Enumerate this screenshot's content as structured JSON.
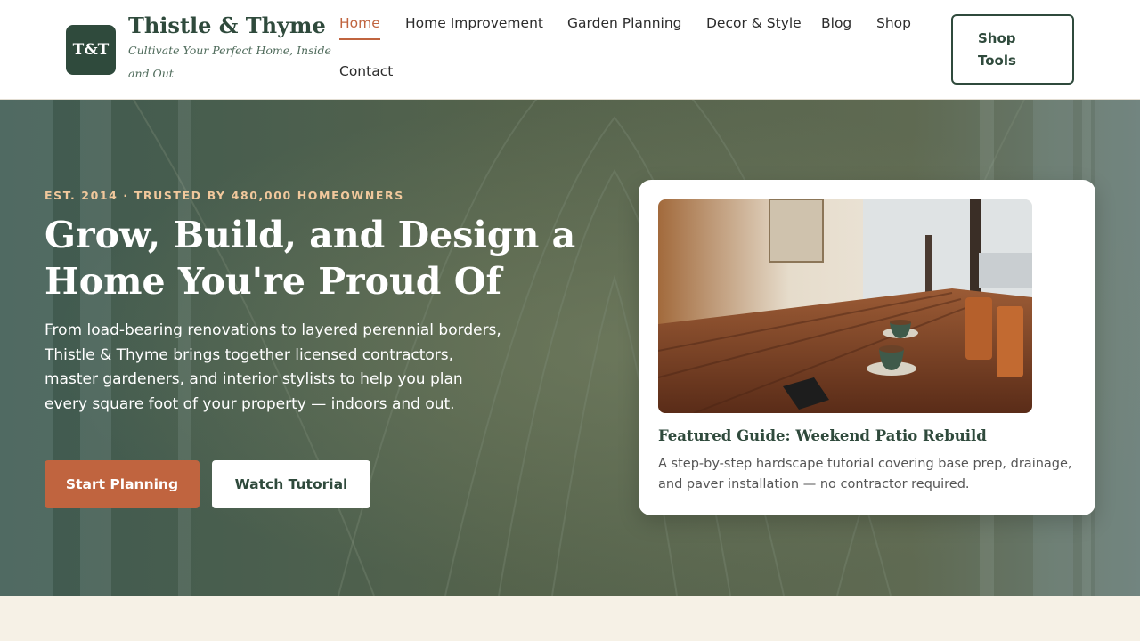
{
  "brand": {
    "logo_text": "T&T",
    "name": "Thistle & Thyme",
    "tagline": "Cultivate Your Perfect Home, Inside and Out"
  },
  "nav": {
    "items": [
      {
        "label": "Home",
        "active": true
      },
      {
        "label": "Home Improvement"
      },
      {
        "label": "Garden Planning"
      },
      {
        "label": "Decor & Style"
      },
      {
        "label": "Blog"
      },
      {
        "label": "Shop"
      },
      {
        "label": "Contact"
      }
    ],
    "shop_tools": "Shop Tools"
  },
  "hero": {
    "eyebrow": "EST. 2014 · TRUSTED BY 480,000 HOMEOWNERS",
    "title": "Grow, Build, and Design a Home You're Proud Of",
    "description": "From load-bearing renovations to layered perennial borders, Thistle & Thyme brings together licensed contractors, master gardeners, and interior stylists to help you plan every square foot of your property — indoors and out.",
    "primary_cta": "Start Planning",
    "secondary_cta": "Watch Tutorial"
  },
  "featured": {
    "title": "Featured Guide: Weekend Patio Rebuild",
    "description": "A step-by-step hardscape tutorial covering base prep, drainage, and paver installation — no contractor required."
  },
  "colors": {
    "brand_green": "#2f4a3c",
    "accent_terracotta": "#c0643f",
    "eyebrow_peach": "#f1c89c",
    "page_cream": "#f6f1e6"
  }
}
